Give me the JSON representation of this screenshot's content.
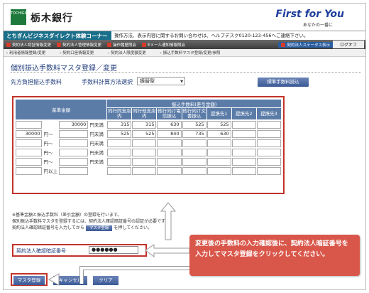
{
  "header": {
    "logo_text": "TOCHIGIN",
    "bank_name": "栃木銀行",
    "brand": "First for You",
    "brand_sub": "あなたの一番に"
  },
  "bar": {
    "demo_label": "とちぎんビジネスダイレクト体験コーナー",
    "inquiry": "操作方法、表示内容に関するお問い合わせは、ヘルプデスク0120-123-456へご連絡下さい。"
  },
  "nav": {
    "items": [
      "契約法人認証情報変更",
      "契約法人管理情報変更",
      "操作履歴照会",
      "Eメール通知情報照会"
    ],
    "status": "契約法人ステータス表示",
    "logoff": "ログオフ"
  },
  "subnav": {
    "items": [
      "利用者情報登録/変更",
      "契約口座情報変更",
      "契約法人限度額変更",
      "振込手数料マスタ登録/変更/参照"
    ]
  },
  "page": {
    "title": "個別振込手数料マスタ登録／変更",
    "payer_label": "先方負担振込手数料",
    "calc_label": "手数料計算方法選択",
    "calc_value": "振替型",
    "std_button": "標準手数料読込"
  },
  "table": {
    "col_amount": "基準金額",
    "col_fee_group": "振込手数料(差引金額)",
    "fee_headers": [
      "同行同支店内",
      "同行他支店内",
      "他行向け電信振込",
      "他行向け文書振込",
      "提携先1",
      "提携先2",
      "提携先3"
    ],
    "rows": [
      {
        "from": "",
        "sep": "",
        "to": "30000",
        "unit": "円未満",
        "fees": [
          "315",
          "315",
          "630",
          "525",
          "525",
          "",
          ""
        ]
      },
      {
        "from": "30000",
        "sep": "円〜",
        "to": "",
        "unit": "円未満",
        "fees": [
          "525",
          "525",
          "840",
          "735",
          "630",
          "",
          ""
        ]
      },
      {
        "from": "",
        "sep": "円〜",
        "to": "",
        "unit": "円未満",
        "fees": [
          "",
          "",
          "",
          "",
          "",
          "",
          ""
        ]
      },
      {
        "from": "",
        "sep": "円〜",
        "to": "",
        "unit": "円未満",
        "fees": [
          "",
          "",
          "",
          "",
          "",
          "",
          ""
        ]
      },
      {
        "from": "",
        "sep": "円〜",
        "to": "",
        "unit": "円未満",
        "fees": [
          "",
          "",
          "",
          "",
          "",
          "",
          ""
        ]
      },
      {
        "from": "",
        "sep": "円以上",
        "to": "",
        "unit": "",
        "fees": [
          "",
          "",
          "",
          "",
          "",
          "",
          ""
        ]
      }
    ]
  },
  "notes": {
    "line1": "※基準金額と振込手数料（差引金額）の登録を行います。",
    "line2": "個別振込手数料マスタを登録するには、契約法人確認暗証番号の認証が必要です。",
    "line3_pre": "契約法人確認暗証番号を入力してから",
    "line3_btn": "マスタ登録",
    "line3_post": "を押してください。"
  },
  "password": {
    "label": "契約法人確認暗証番号",
    "value": "●●●●●●"
  },
  "buttons": {
    "register": "マスタ登録",
    "cancel": "キャンセル",
    "clear": "クリア"
  },
  "callout": {
    "text": "変更後の手数料の入力確認後に、契約法人暗証番号を入力してマスタ登録をクリックしてください。"
  },
  "colors": {
    "accent_red": "#c2332a",
    "header_blue": "#5c7ca8",
    "demo_teal": "#1a6f8a",
    "callout_bg": "#d9574a"
  }
}
